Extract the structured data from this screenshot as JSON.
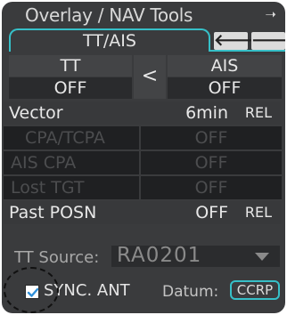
{
  "window": {
    "title": "Overlay / NAV Tools"
  },
  "tab": {
    "label": "TT/AIS"
  },
  "grid": {
    "tt_label": "TT",
    "tt_value": "OFF",
    "transfer_label": "<",
    "ais_label": "AIS",
    "ais_value": "OFF"
  },
  "rows": {
    "vector": {
      "label": "Vector",
      "value": "6min",
      "mode": "REL"
    },
    "cpa_tcpa": {
      "label": "CPA/TCPA",
      "value": "OFF"
    },
    "ais_cpa": {
      "label": "AIS CPA",
      "value": "OFF"
    },
    "lost_tgt": {
      "label": "Lost TGT",
      "value": "OFF"
    },
    "past_posn": {
      "label": "Past POSN",
      "value": "OFF",
      "mode": "REL"
    }
  },
  "tt_source": {
    "label": "TT Source:",
    "value": "RA0201"
  },
  "sync_ant": {
    "label": "SYNC. ANT",
    "checked": true
  },
  "datum": {
    "label": "Datum:",
    "value": "CCRP"
  },
  "colors": {
    "accent": "#36c0c8",
    "panel": "#3a3b3d"
  }
}
